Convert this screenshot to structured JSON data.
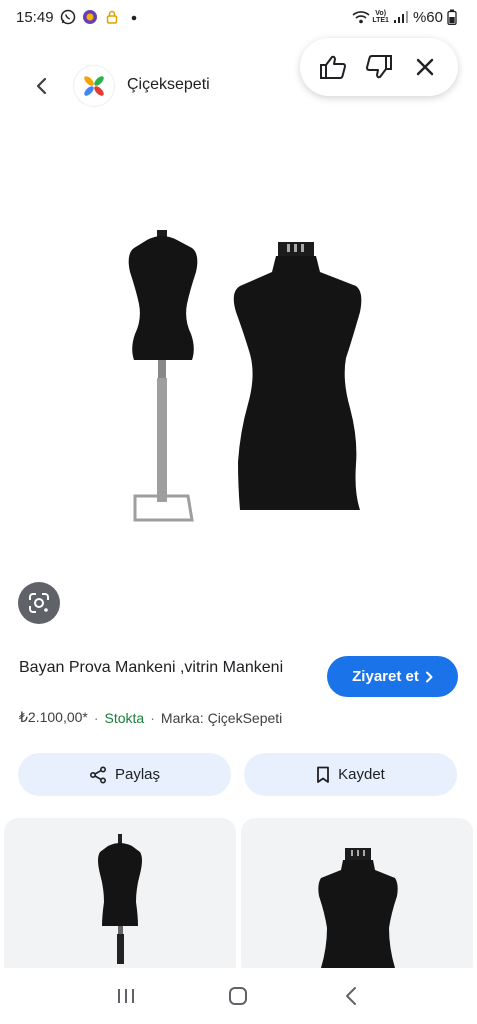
{
  "status_bar": {
    "time": "15:49",
    "network": "Vo)\nLTE1",
    "battery": "%60"
  },
  "header": {
    "site_name": "Çiçeksepeti"
  },
  "product": {
    "title": "Bayan Prova Mankeni ,vitrin Mankeni",
    "price": "₺2.100,00*",
    "stock": "Stokta",
    "brand": "Marka: ÇiçekSepeti",
    "visit_label": "Ziyaret et"
  },
  "actions": {
    "share_label": "Paylaş",
    "save_label": "Kaydet"
  },
  "colors": {
    "accent": "#1a73e8",
    "stock_green": "#188038",
    "action_bg": "#e8f0fe"
  }
}
